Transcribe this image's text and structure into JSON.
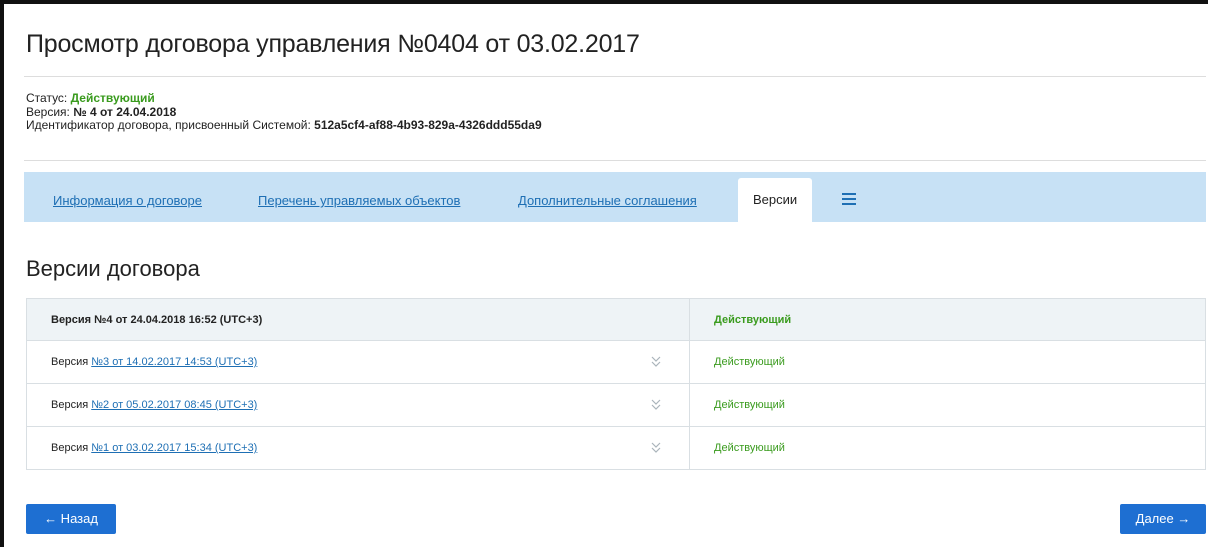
{
  "title": "Просмотр договора управления №0404 от 03.02.2017",
  "meta": {
    "status_label": "Статус: ",
    "status_value": "Действующий",
    "version_label": "Версия: ",
    "version_value": "№ 4 от 24.04.2018",
    "id_label": "Идентификатор договора, присвоенный Системой: ",
    "id_value": "512a5cf4-af88-4b93-829a-4326ddd55da9"
  },
  "tabs": [
    {
      "label": "Информация о договоре"
    },
    {
      "label": "Перечень управляемых объектов"
    },
    {
      "label": "Дополнительные соглашения"
    },
    {
      "label": "Версии"
    }
  ],
  "section_title": "Версии договора",
  "versions": {
    "current": {
      "label": "Версия №4 от 24.04.2018 16:52 (UTC+3)",
      "status": "Действующий"
    },
    "rows": [
      {
        "prefix": "Версия ",
        "link": "№3 от 14.02.2017 14:53 (UTC+3)",
        "status": "Действующий"
      },
      {
        "prefix": "Версия ",
        "link": "№2 от 05.02.2017 08:45 (UTC+3)",
        "status": "Действующий"
      },
      {
        "prefix": "Версия ",
        "link": "№1 от 03.02.2017 15:34 (UTC+3)",
        "status": "Действующий"
      }
    ]
  },
  "buttons": {
    "back": "← Назад",
    "next": "Далее →"
  },
  "colors": {
    "accent": "#1e6fd2",
    "link": "#1e6fb4",
    "status_green": "#3a9b1e",
    "tabbar_bg": "#c7e1f5"
  }
}
